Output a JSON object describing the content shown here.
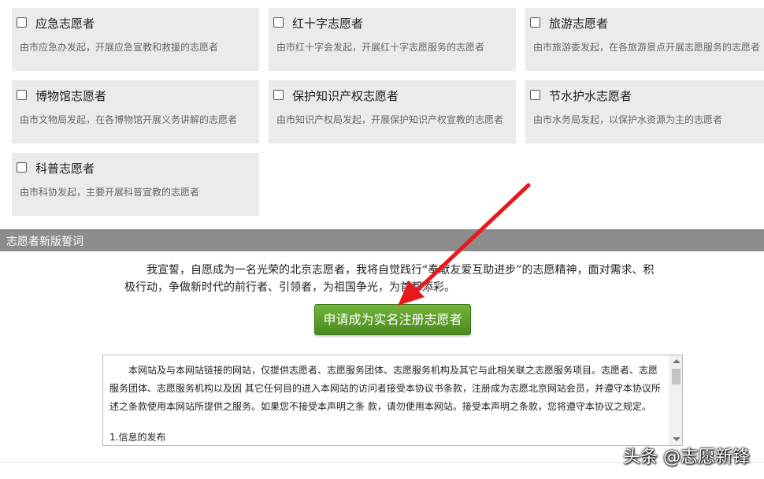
{
  "cards": [
    {
      "title": "应急志愿者",
      "desc": "由市应急办发起，开展应急宣教和救援的志愿者"
    },
    {
      "title": "红十字志愿者",
      "desc": "由市红十字会发起，开展红十字志愿服务的志愿者"
    },
    {
      "title": "旅游志愿者",
      "desc": "由市旅游委发起，在各旅游景点开展志愿服务的志愿者"
    },
    {
      "title": "博物馆志愿者",
      "desc": "由市文物局发起，在各博物馆开展义务讲解的志愿者"
    },
    {
      "title": "保护知识产权志愿者",
      "desc": "由市知识产权局发起，开展保护知识产权宣教的志愿者"
    },
    {
      "title": "节水护水志愿者",
      "desc": "由市水务局发起，以保护水资源为主的志愿者"
    },
    {
      "title": "科普志愿者",
      "desc": "由市科协发起，主要开展科普宣教的志愿者"
    }
  ],
  "pledge": {
    "header": "志愿者新版誓词",
    "text": "我宣誓，自愿成为一名光荣的北京志愿者，我将自觉践行“奉献友爱互助进步”的志愿精神，面对需求、积极行动，争做新时代的前行者、引领者，为祖国争光，为首都添彩。"
  },
  "apply_button": "申请成为实名注册志愿者",
  "terms": {
    "paragraph1": "本网站及与本网站链接的网站，仅提供志愿者、志愿服务团体、志愿服务机构及其它与此相关联之志愿服务项目。志愿者、志愿服务团体、志愿服务机构以及因 其它任何目的进入本网站的访问者接受本协议书条款，注册成为志愿北京网站会员，并遵守本协议所述之条款使用本网站所提供之服务。如果您不接受本声明之条 款，请勿使用本网站。接受本声明之条款，您将遵守本协议之规定。",
    "heading1": "1.信息的发布"
  },
  "watermark": "头条 @志愿新锋",
  "colors": {
    "button": "#5a9b28",
    "arrow": "#e8191c",
    "section_bar": "#8c8c8c",
    "card_bg": "#ebebeb"
  },
  "icons": {
    "checkbox": "checkbox-icon",
    "arrow": "red-arrow-annotation"
  }
}
